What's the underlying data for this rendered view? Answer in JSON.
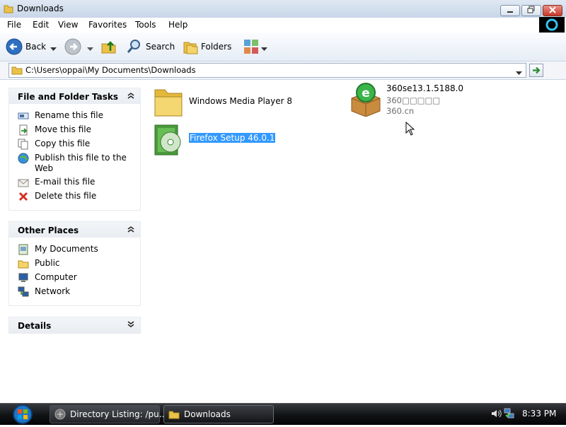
{
  "window": {
    "title": "Downloads"
  },
  "menu": [
    "File",
    "Edit",
    "View",
    "Favorites",
    "Tools",
    "Help"
  ],
  "toolbar": {
    "back": "Back",
    "search": "Search",
    "folders": "Folders"
  },
  "address": {
    "path": "C:\\Users\\oppai\\My Documents\\Downloads"
  },
  "tasks_panel": {
    "title": "File and Folder Tasks",
    "items": [
      {
        "label": "Rename this file",
        "icon": "rename-icon"
      },
      {
        "label": "Move this file",
        "icon": "move-icon"
      },
      {
        "label": "Copy this file",
        "icon": "copy-icon"
      },
      {
        "label": "Publish this file to the Web",
        "icon": "publish-web-icon"
      },
      {
        "label": "E-mail this file",
        "icon": "email-icon"
      },
      {
        "label": "Delete this file",
        "icon": "delete-icon"
      }
    ]
  },
  "places_panel": {
    "title": "Other Places",
    "items": [
      {
        "label": "My Documents",
        "icon": "my-documents-icon"
      },
      {
        "label": "Public",
        "icon": "folder-icon"
      },
      {
        "label": "Computer",
        "icon": "computer-icon"
      },
      {
        "label": "Network",
        "icon": "network-icon"
      }
    ]
  },
  "details_panel": {
    "title": "Details"
  },
  "files": [
    {
      "name": "Windows Media Player 8",
      "icon": "folder-icon"
    },
    {
      "name": "360se13.1.5188.0",
      "line2": "360□□□□□",
      "line3": "360.cn",
      "icon": "installer-box-icon"
    },
    {
      "name": "Firefox Setup 46.0.1",
      "icon": "setup-cd-icon",
      "selected": true
    }
  ],
  "taskbar": {
    "items": [
      {
        "label": "Directory Listing: /pu...",
        "icon": "browser-icon"
      },
      {
        "label": "Downloads",
        "icon": "folder-icon",
        "active": true
      }
    ],
    "clock": "8:33 PM"
  },
  "colors": {
    "selection": "#3399ff",
    "taskbar": "#101214",
    "accent": "#1e74c7"
  }
}
